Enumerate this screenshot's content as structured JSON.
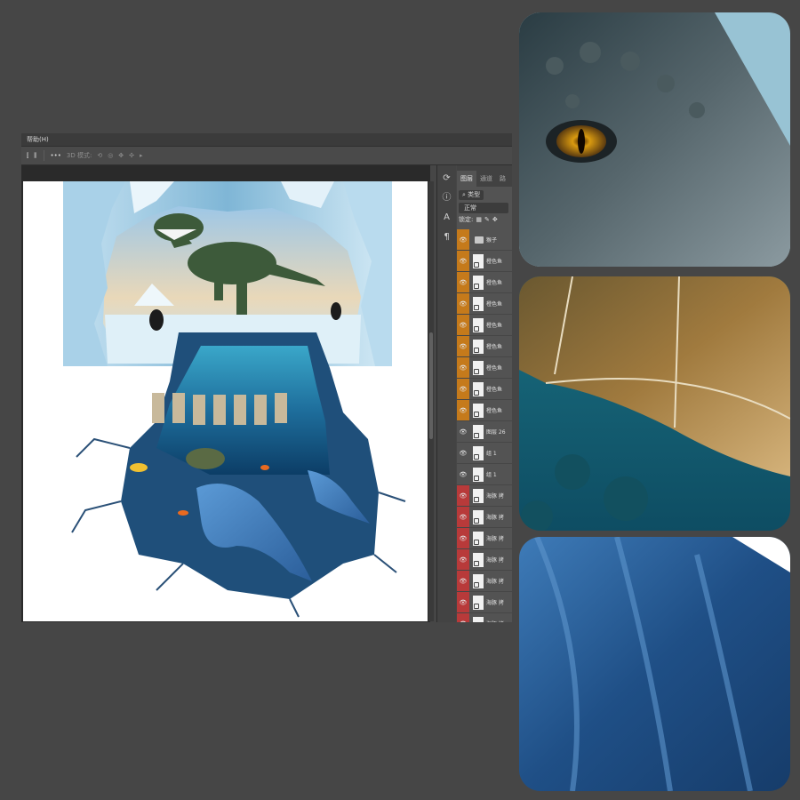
{
  "menu": {
    "help_label": "帮助(H)"
  },
  "options_bar": {
    "more_label": "•••",
    "mode_label": "3D 模式:"
  },
  "layers_panel": {
    "tabs": [
      {
        "label": "图层"
      },
      {
        "label": "通道"
      },
      {
        "label": "路"
      }
    ],
    "filter_label": "类型",
    "blend_mode": "正常",
    "lock_label": "锁定:",
    "layers": [
      {
        "name": "猴子",
        "type": "group",
        "color": "#c57a1b"
      },
      {
        "name": "橙色鱼",
        "type": "layer",
        "color": "#c57a1b"
      },
      {
        "name": "橙色鱼",
        "type": "layer",
        "color": "#c57a1b"
      },
      {
        "name": "橙色鱼",
        "type": "layer",
        "color": "#c57a1b"
      },
      {
        "name": "橙色鱼",
        "type": "layer",
        "color": "#c57a1b"
      },
      {
        "name": "橙色鱼",
        "type": "layer",
        "color": "#c57a1b"
      },
      {
        "name": "橙色鱼",
        "type": "layer",
        "color": "#c57a1b"
      },
      {
        "name": "橙色鱼",
        "type": "layer",
        "color": "#c57a1b"
      },
      {
        "name": "橙色鱼",
        "type": "layer",
        "color": "#c57a1b"
      },
      {
        "name": "图层 26",
        "type": "layer",
        "color": ""
      },
      {
        "name": "组 1",
        "type": "layer",
        "color": ""
      },
      {
        "name": "组 1",
        "type": "layer",
        "color": ""
      },
      {
        "name": "海豚 拷",
        "type": "layer",
        "color": "#b83a3a"
      },
      {
        "name": "海豚 拷",
        "type": "layer",
        "color": "#b83a3a"
      },
      {
        "name": "海豚 拷",
        "type": "layer",
        "color": "#b83a3a"
      },
      {
        "name": "海豚 拷",
        "type": "layer",
        "color": "#b83a3a"
      },
      {
        "name": "海豚 拷",
        "type": "layer",
        "color": "#b83a3a"
      },
      {
        "name": "海豚 拷",
        "type": "layer",
        "color": "#b83a3a"
      },
      {
        "name": "海豚 拷",
        "type": "layer",
        "color": "#b83a3a"
      }
    ]
  },
  "colors": {
    "background": "#464646",
    "ice": "#7fb6d6",
    "ocean": "#1e6e9c",
    "dolphin": "#3d7ec0"
  }
}
